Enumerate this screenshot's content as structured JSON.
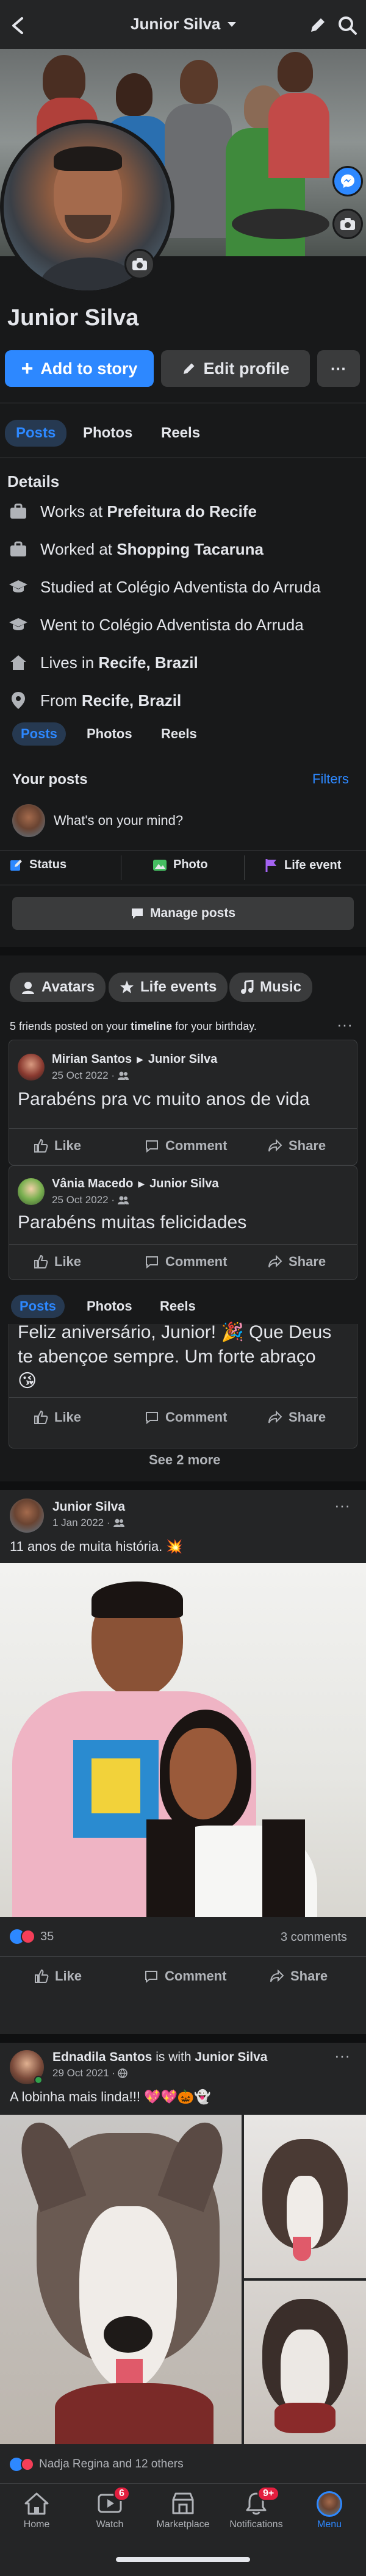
{
  "header": {
    "title": "Junior Silva"
  },
  "profile": {
    "name": "Junior Silva",
    "add_story_label": "Add to story",
    "edit_profile_label": "Edit profile",
    "more_label": "···"
  },
  "tabs": [
    "Posts",
    "Photos",
    "Reels"
  ],
  "details": {
    "title": "Details",
    "items": [
      {
        "icon": "briefcase-icon",
        "prefix": "Works at ",
        "bold": "Prefeitura do Recife"
      },
      {
        "icon": "briefcase-icon",
        "prefix": "Worked at ",
        "bold": "Shopping Tacaruna"
      },
      {
        "icon": "graduation-cap-icon",
        "prefix": "Studied at Colégio Adventista do Arruda",
        "bold": ""
      },
      {
        "icon": "graduation-cap-icon",
        "prefix": "Went to Colégio Adventista do Arruda",
        "bold": ""
      },
      {
        "icon": "home-icon",
        "prefix": "Lives in ",
        "bold": "Recife, Brazil"
      },
      {
        "icon": "location-pin-icon",
        "prefix": "From ",
        "bold": "Recife, Brazil"
      }
    ]
  },
  "your_posts": {
    "title": "Your posts",
    "filters_label": "Filters",
    "composer_placeholder": "What's on your mind?",
    "status_label": "Status",
    "photo_label": "Photo",
    "life_event_label": "Life event",
    "manage_posts_label": "Manage posts"
  },
  "chips": {
    "avatars": "Avatars",
    "life_events": "Life events",
    "music": "Music"
  },
  "birthday": {
    "prefix": "5 friends posted on your ",
    "bold": "timeline",
    "suffix": " for your birthday.",
    "posts": [
      {
        "author": "Mirian Santos",
        "target": "Junior Silva",
        "date": "25 Oct 2022 · ",
        "text": "Parabéns pra vc muito anos de vida"
      },
      {
        "author": "Vânia Macedo",
        "target": "Junior Silva",
        "date": "25 Oct 2022 · ",
        "text": "Parabéns muitas felicidades"
      },
      {
        "author": "",
        "target": "",
        "date": "",
        "text": "Feliz aniversário, Junior! 🎉 Que Deus te abençoe sempre. Um forte abraço 😘"
      }
    ],
    "see_more": "See 2 more"
  },
  "actions": {
    "like": "Like",
    "comment": "Comment",
    "share": "Share"
  },
  "post1": {
    "author": "Junior Silva",
    "date": "1 Jan 2022 · ",
    "text": "11 anos de muita história. 💥",
    "reactions": "35",
    "comments": "3 comments"
  },
  "post2": {
    "author": "Ednadila Santos",
    "with_text": " is with ",
    "with_name": "Junior Silva",
    "date": "29 Oct 2021 · ",
    "text": "A lobinha mais linda!!! 💖💖🎃👻",
    "reactions": "Nadja Regina and 12 others"
  },
  "nav": {
    "items": [
      {
        "label": "Home",
        "icon": "home-icon",
        "badge": ""
      },
      {
        "label": "Watch",
        "icon": "watch-icon",
        "badge": "6"
      },
      {
        "label": "Marketplace",
        "icon": "marketplace-icon",
        "badge": ""
      },
      {
        "label": "Notifications",
        "icon": "bell-icon",
        "badge": "9+"
      },
      {
        "label": "Menu",
        "icon": "profile-menu-icon",
        "badge": ""
      }
    ]
  },
  "colors": {
    "accent": "#2d88ff",
    "background": "#18191a",
    "card": "#242526",
    "badge": "#e41e3f"
  }
}
